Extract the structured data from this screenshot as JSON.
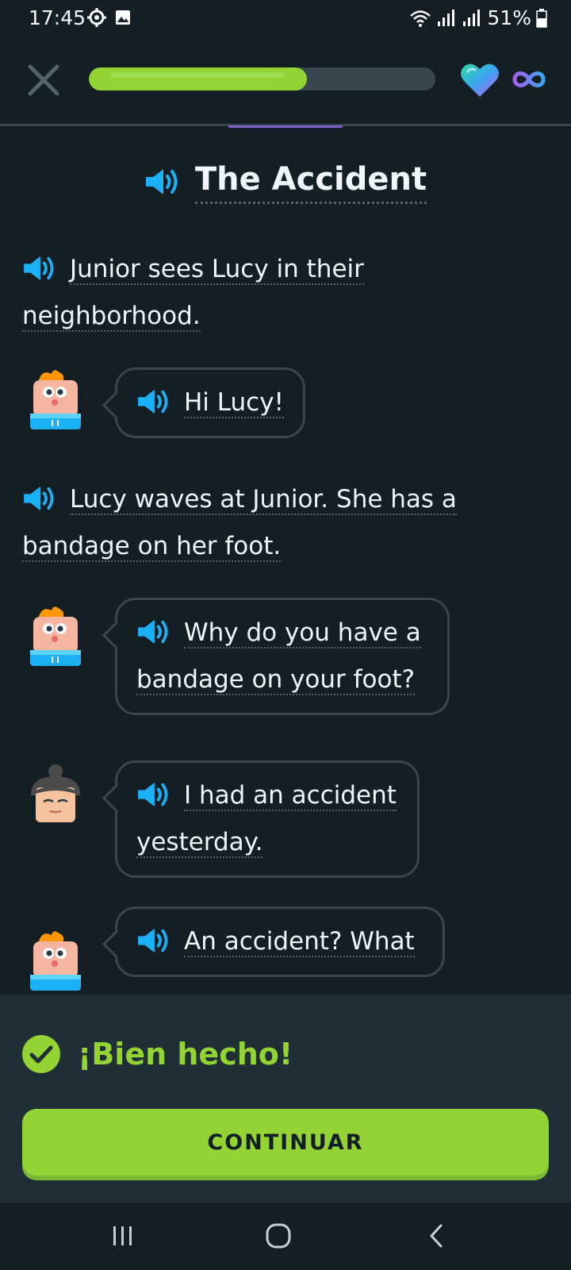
{
  "status_bar": {
    "time": "17:45",
    "battery": "51%"
  },
  "lesson": {
    "progress_fraction": 0.63
  },
  "story": {
    "title": "The Accident",
    "lines": [
      {
        "type": "narration",
        "text": "Junior sees Lucy in their neighborhood."
      },
      {
        "type": "dialogue",
        "speaker": "Junior",
        "text": "Hi Lucy!"
      },
      {
        "type": "narration",
        "text": "Lucy waves at Junior. She has a bandage on her foot."
      },
      {
        "type": "dialogue",
        "speaker": "Junior",
        "text": "Why do you have a bandage on your foot?"
      },
      {
        "type": "dialogue",
        "speaker": "Lucy",
        "text": "I had an accident yesterday."
      },
      {
        "type": "dialogue",
        "speaker": "Junior",
        "text": "An accident? What"
      }
    ]
  },
  "feedback": {
    "message": "¡Bien hecho!",
    "continue_label": "CONTINUAR"
  },
  "colors": {
    "background": "#131f24",
    "accent_green": "#93d333",
    "speaker_blue": "#1cb0f6",
    "border": "#37464f"
  },
  "icons": [
    "gear-icon",
    "gallery-icon",
    "wifi-icon",
    "signal-icon",
    "battery-icon",
    "close-icon",
    "heart-icon",
    "infinity-icon",
    "speaker-icon",
    "check-circle-icon",
    "recent-apps-icon",
    "home-icon",
    "back-icon"
  ]
}
